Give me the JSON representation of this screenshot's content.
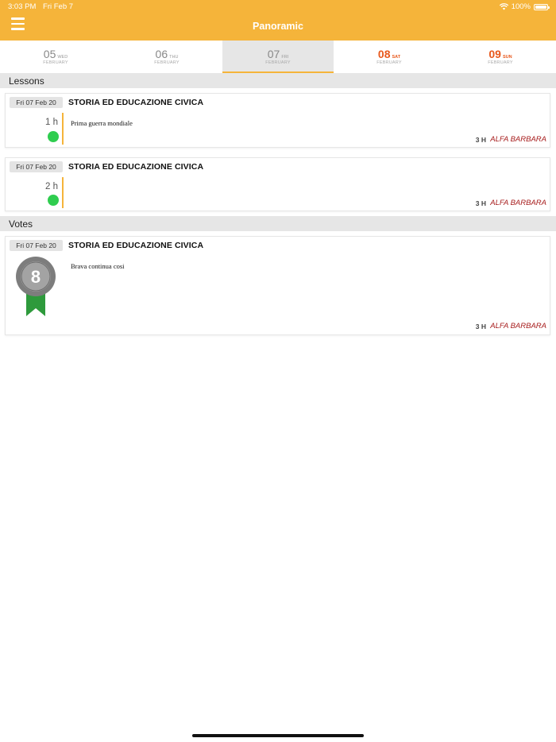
{
  "status_bar": {
    "time": "3:03 PM",
    "date": "Fri Feb 7",
    "battery": "100%"
  },
  "header": {
    "title": "Panoramic"
  },
  "dates": [
    {
      "day": "05",
      "abbr": "WED",
      "month": "FEBRUARY"
    },
    {
      "day": "06",
      "abbr": "THU",
      "month": "FEBRUARY"
    },
    {
      "day": "07",
      "abbr": "FRI",
      "month": "FEBRUARY"
    },
    {
      "day": "08",
      "abbr": "SAT",
      "month": "FEBRUARY"
    },
    {
      "day": "09",
      "abbr": "SUN",
      "month": "FEBRUARY"
    }
  ],
  "lessons": {
    "title": "Lessons",
    "items": [
      {
        "date": "Fri 07 Feb 20",
        "subject": "STORIA ED EDUCAZIONE CIVICA",
        "hour": "1 h",
        "note": "Prima guerra mondiale",
        "hours_count": "3 H",
        "teacher": "ALFA BARBARA"
      },
      {
        "date": "Fri 07 Feb 20",
        "subject": "STORIA ED EDUCAZIONE CIVICA",
        "hour": "2 h",
        "note": "",
        "hours_count": "3 H",
        "teacher": "ALFA BARBARA"
      }
    ]
  },
  "votes": {
    "title": "Votes",
    "items": [
      {
        "date": "Fri 07 Feb 20",
        "subject": "STORIA ED EDUCAZIONE CIVICA",
        "grade": "8",
        "note": "Brava continua cosi",
        "hours_count": "3 H",
        "teacher": "ALFA BARBARA"
      }
    ]
  },
  "colors": {
    "accent": "#f5b43a",
    "weekend": "#e8591d",
    "teacher": "#a71d1d",
    "dot": "#2fcd4f",
    "ribbon": "#2e9a3c"
  }
}
